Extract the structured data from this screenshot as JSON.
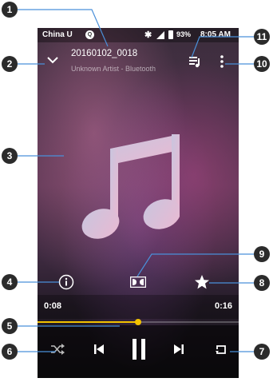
{
  "status_bar": {
    "carrier": "China U",
    "battery": "93%",
    "time": "8:05 AM"
  },
  "track": {
    "title": "20160102_0018",
    "subtitle": "Unknown Artist - Bluetooth"
  },
  "playback": {
    "elapsed": "0:08",
    "total": "0:16",
    "progress_fraction": 0.5
  },
  "callouts": {
    "c1": "1",
    "c2": "2",
    "c3": "3",
    "c4": "4",
    "c5": "5",
    "c6": "6",
    "c7": "7",
    "c8": "8",
    "c9": "9",
    "c10": "10",
    "c11": "11"
  },
  "colors": {
    "accent": "#f2c200",
    "badge": "#2b2b2b",
    "callout_line": "#4a90d9"
  },
  "icons": {
    "collapse": "chevron-down-icon",
    "queue": "playlist-icon",
    "more": "more-vertical-icon",
    "info": "info-icon",
    "dolby": "dolby-icon",
    "favorite": "star-icon",
    "shuffle": "shuffle-icon",
    "previous": "skip-previous-icon",
    "pause": "pause-icon",
    "next": "skip-next-icon",
    "repeat": "repeat-icon",
    "album_art": "music-note-icon"
  }
}
